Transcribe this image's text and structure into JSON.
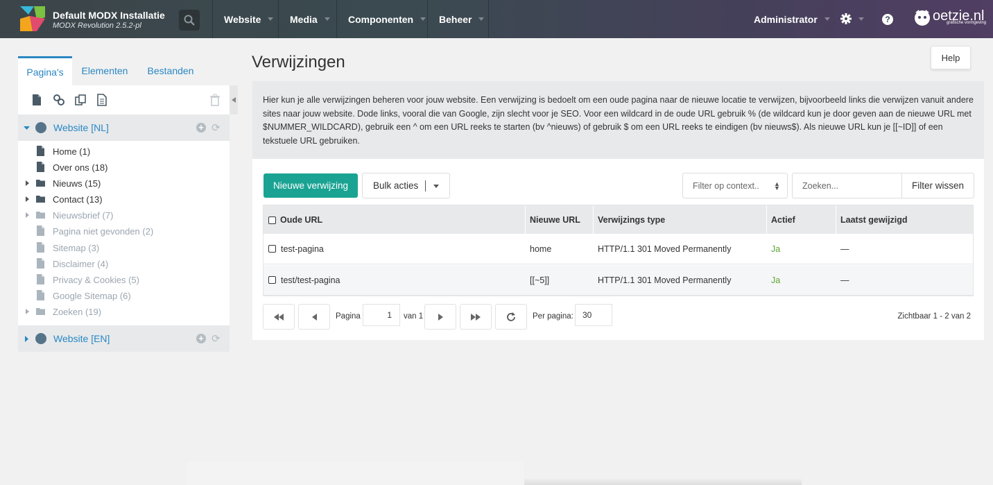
{
  "header": {
    "site_title": "Default MODX Installatie",
    "site_version": "MODX Revolution 2.5.2-pl",
    "nav": [
      "Website",
      "Media",
      "Componenten",
      "Beheer"
    ],
    "user": "Administrator",
    "brand": "oetzie.nl",
    "brand_sub": "grafische vormgeving"
  },
  "left_panel": {
    "tabs": [
      "Pagina's",
      "Elementen",
      "Bestanden"
    ],
    "contexts": [
      {
        "label": "Website [NL]",
        "expanded": true
      },
      {
        "label": "Website [EN]",
        "expanded": false
      }
    ],
    "nodes": [
      {
        "label": "Home (1)",
        "type": "doc",
        "dim": false,
        "children": false
      },
      {
        "label": "Over ons (18)",
        "type": "doc",
        "dim": false,
        "children": false
      },
      {
        "label": "Nieuws (15)",
        "type": "folder",
        "dim": false,
        "children": true
      },
      {
        "label": "Contact (13)",
        "type": "folder",
        "dim": false,
        "children": true
      },
      {
        "label": "Nieuwsbrief (7)",
        "type": "folder",
        "dim": true,
        "children": true
      },
      {
        "label": "Pagina niet gevonden (2)",
        "type": "doc",
        "dim": true,
        "children": false
      },
      {
        "label": "Sitemap (3)",
        "type": "doc",
        "dim": true,
        "children": false
      },
      {
        "label": "Disclaimer (4)",
        "type": "doc",
        "dim": true,
        "children": false
      },
      {
        "label": "Privacy & Cookies (5)",
        "type": "doc",
        "dim": true,
        "children": false
      },
      {
        "label": "Google Sitemap (6)",
        "type": "doc",
        "dim": true,
        "children": false
      },
      {
        "label": "Zoeken (19)",
        "type": "folder",
        "dim": true,
        "children": true
      }
    ]
  },
  "main": {
    "title": "Verwijzingen",
    "help_label": "Help",
    "description": "Hier kun je alle verwijzingen beheren voor jouw website. Een verwijzing is bedoelt om een oude pagina naar de nieuwe locatie te verwijzen, bijvoorbeeld links die verwijzen vanuit andere sites naar jouw website. Dode links, vooral die van Google, zijn slecht voor je SEO. Voor een wildcard in de oude URL gebruik % (de wildcard kun je door geven aan de nieuwe URL met $NUMMER_WILDCARD), gebruik een ^ om een URL reeks te starten (bv ^nieuws) of gebruik $ om een URL reeks te eindigen (bv nieuws$). Als nieuwe URL kun je [[~ID]] of een tekstuele URL gebruiken.",
    "new_button": "Nieuwe verwijzing",
    "bulk_button": "Bulk acties",
    "context_filter_placeholder": "Filter op context..",
    "search_placeholder": "Zoeken...",
    "clear_button": "Filter wissen",
    "columns": [
      "Oude URL",
      "Nieuwe URL",
      "Verwijzings type",
      "Actief",
      "Laatst gewijzigd"
    ],
    "rows": [
      {
        "old": "test-pagina",
        "new": "home",
        "type": "HTTP/1.1 301 Moved Permanently",
        "active": "Ja",
        "modified": "—"
      },
      {
        "old": "test/test-pagina",
        "new": "[[~5]]",
        "type": "HTTP/1.1 301 Moved Permanently",
        "active": "Ja",
        "modified": "—"
      }
    ],
    "pager": {
      "page_label": "Pagina",
      "page": "1",
      "of_label": "van 1",
      "per_page_label": "Per pagina:",
      "per_page": "30",
      "visible": "Zichtbaar 1 - 2 van 2"
    }
  },
  "colors": {
    "accent": "#2a87c3",
    "primary_button": "#1aa393",
    "active_green": "#5ca433"
  }
}
